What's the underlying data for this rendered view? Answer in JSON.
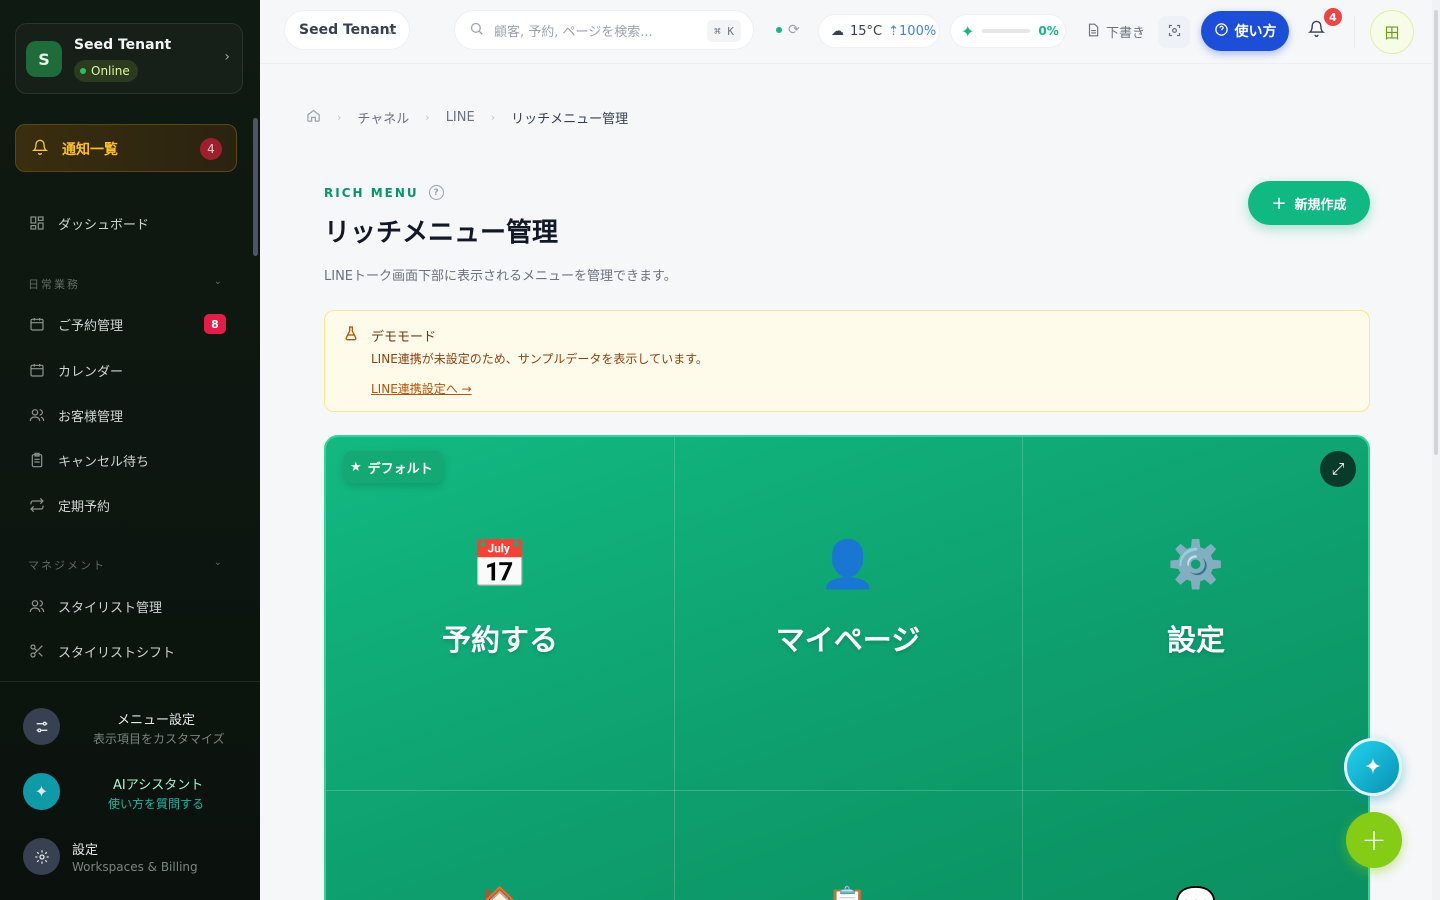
{
  "sidebar": {
    "tenant": {
      "initial": "S",
      "name": "Seed Tenant",
      "status": "Online"
    },
    "notifications": {
      "label": "通知一覧",
      "count": "4"
    },
    "dashboard": "ダッシュボード",
    "section_daily": "日常業務",
    "items_daily": [
      {
        "label": "ご予約管理",
        "badge": "8",
        "icon": "calendar-icon"
      },
      {
        "label": "カレンダー",
        "icon": "calendar-icon"
      },
      {
        "label": "お客様管理",
        "icon": "users-icon"
      },
      {
        "label": "キャンセル待ち",
        "icon": "clipboard-icon"
      },
      {
        "label": "定期予約",
        "icon": "repeat-icon"
      }
    ],
    "section_management": "マネジメント",
    "items_management": [
      {
        "label": "スタイリスト管理",
        "icon": "users-icon"
      },
      {
        "label": "スタイリストシフト",
        "icon": "scissors-icon"
      }
    ],
    "footer": {
      "menu_settings": {
        "title": "メニュー設定",
        "sub": "表示項目をカスタマイズ"
      },
      "ai_assistant": {
        "title": "AIアシスタント",
        "sub": "使い方を質問する"
      },
      "settings": {
        "title": "設定",
        "sub": "Workspaces & Billing"
      }
    }
  },
  "topbar": {
    "tenant_select": "Seed Tenant",
    "search_placeholder": "顧客, 予約, ページを検索...",
    "search_shortcut": "⌘ K",
    "weather": {
      "temp": "15°C",
      "humidity": "100%"
    },
    "progress": {
      "value": "0%",
      "fraction": 0
    },
    "draft": "下書き",
    "help": "使い方",
    "notification_count": "4",
    "grid_glyph": "田"
  },
  "breadcrumb": [
    "チャネル",
    "LINE",
    "リッチメニュー管理"
  ],
  "page": {
    "eyebrow": "RICH MENU",
    "title": "リッチメニュー管理",
    "description": "LINEトーク画面下部に表示されるメニューを管理できます。",
    "new_button": "新規作成"
  },
  "demo": {
    "title": "デモモード",
    "desc": "LINE連携が未設定のため、サンプルデータを表示しています。",
    "link": "LINE連携設定へ →"
  },
  "rich_menu": {
    "default_tag": "デフォルト",
    "cells": [
      {
        "emoji": "📅",
        "label": "予約する"
      },
      {
        "emoji": "👤",
        "label": "マイページ"
      },
      {
        "emoji": "⚙️",
        "label": "設定"
      }
    ],
    "row2_emojis": [
      "🏠",
      "📋",
      "💬"
    ],
    "colors": {
      "bg": "#10b981",
      "accent": "#34d399"
    }
  }
}
